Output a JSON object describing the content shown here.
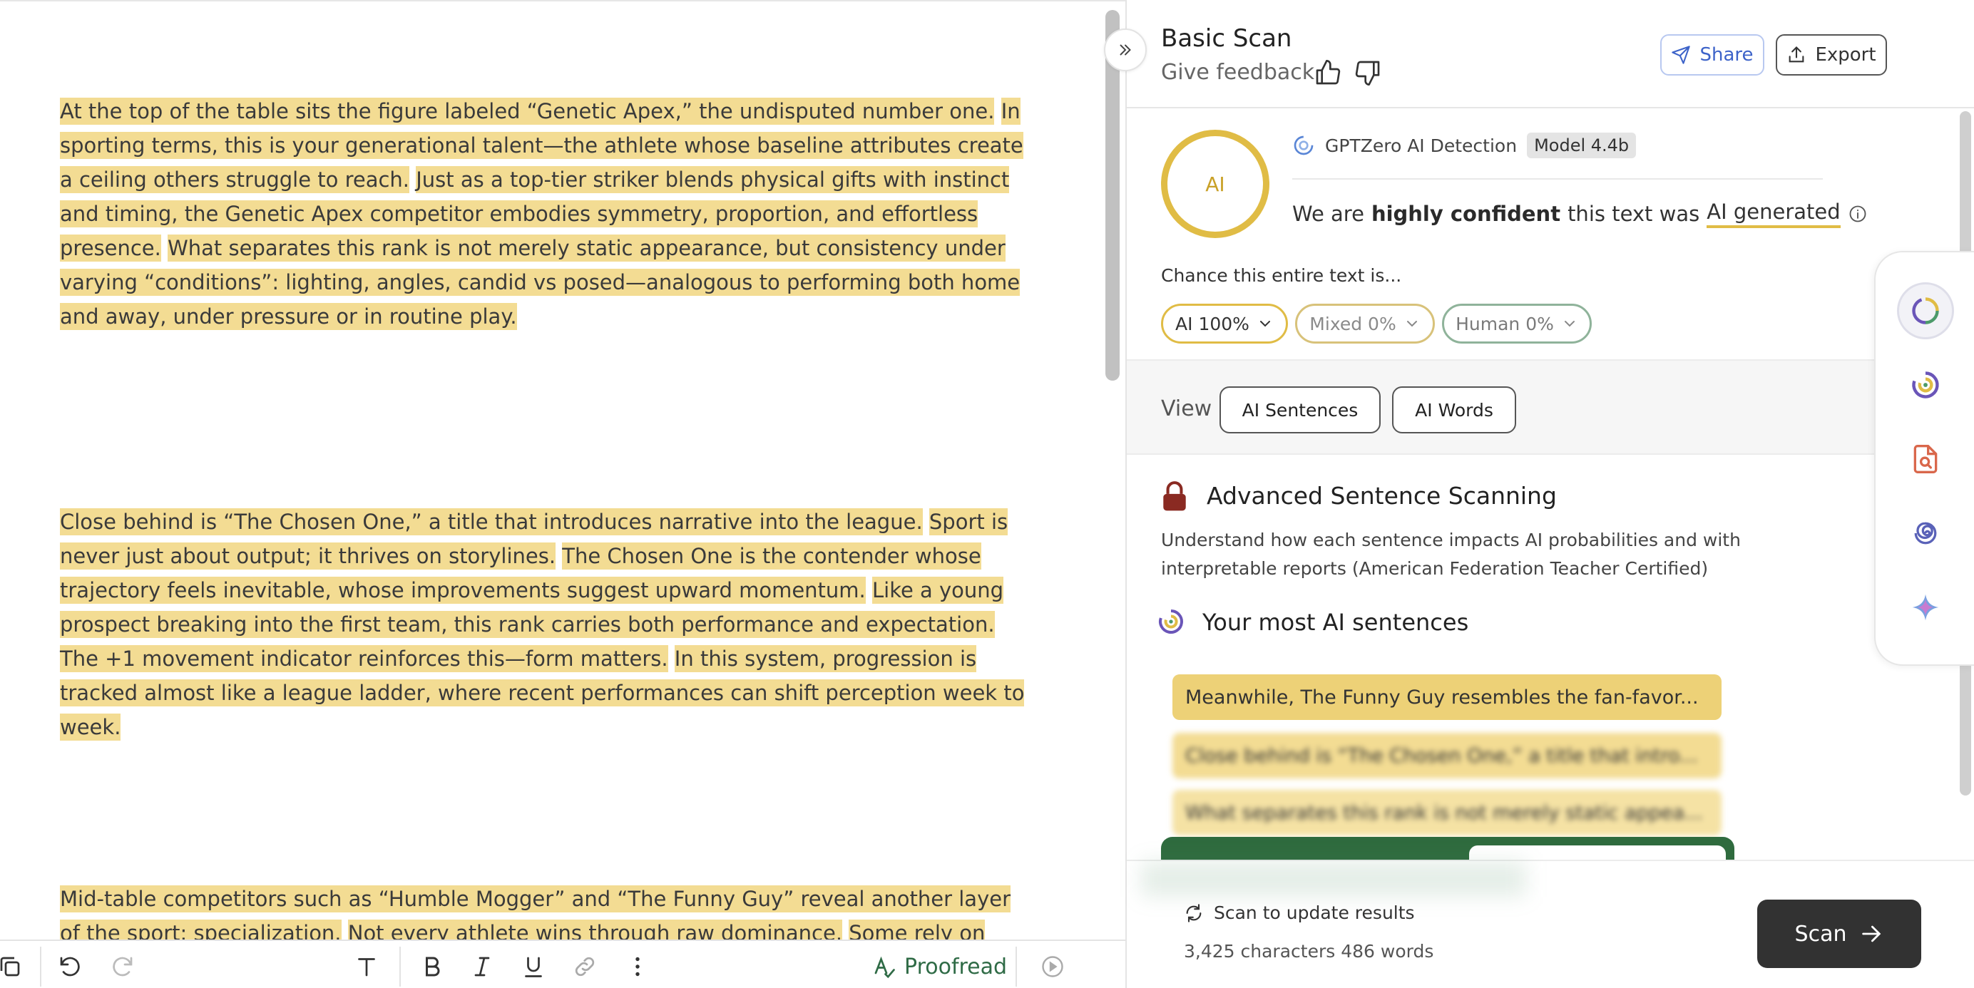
{
  "document": {
    "p1": [
      "At the top of the table sits the figure labeled “Genetic Apex,” the undisputed number one.",
      "In sporting terms, this is your generational talent—the athlete whose baseline attributes create a ceiling others struggle to reach.",
      "Just as a top-tier striker blends physical gifts with instinct and timing, the Genetic Apex competitor embodies symmetry, proportion, and effortless presence.",
      "What separates this rank is not merely static appearance, but consistency under varying “conditions”: lighting, angles, candid vs posed—analogous to performing both home and away, under pressure or in routine play."
    ],
    "p2": [
      "Close behind is “The Chosen One,” a title that introduces narrative into the league.",
      "Sport is never just about output; it thrives on storylines.",
      "The Chosen One is the contender whose trajectory feels inevitable, whose improvements suggest upward momentum.",
      "Like a young prospect breaking into the first team, this rank carries both performance and expectation.",
      "The +1 movement indicator reinforces this—form matters.",
      "In this system, progression is tracked almost like a league ladder, where recent performances can shift perception week to week."
    ],
    "p3": [
      "Mid-table competitors such as “Humble Mogger” and “The Funny Guy” reveal another layer of the sport: specialization.",
      "Not every athlete wins through raw dominance.",
      "Some rely on stylistic flair."
    ]
  },
  "toolbar": {
    "proofread_label": "Proofread"
  },
  "panel": {
    "title": "Basic Scan",
    "feedback": "Give feedback",
    "share_label": "Share",
    "export_label": "Export",
    "ring_label": "AI",
    "detector_name": "GPTZero AI Detection",
    "model_badge": "Model 4.4b",
    "verdict": {
      "prefix": "We are",
      "strong": "highly confident",
      "middle": "this text was",
      "result": "AI generated"
    },
    "chance_label": "Chance this entire text is...",
    "pills": {
      "ai": "AI 100%",
      "mixed": "Mixed 0%",
      "human": "Human 0%"
    },
    "view_label": "View",
    "view_options": [
      "AI Sentences",
      "AI Words"
    ],
    "advanced_title": "Advanced Sentence Scanning",
    "advanced_desc": "Understand how each sentence impacts AI probabilities and with interpretable reports (American Federation Teacher Certified)",
    "most_ai_title": "Your most AI sentences",
    "top_sentences": [
      "Meanwhile, The Funny Guy resembles the fan-favor...",
      "Close behind is “The Chosen One,” a title that intro...",
      "What separates this rank is not merely static appea..."
    ],
    "update_label": "Scan to update results",
    "counts": "3,425 characters 486 words",
    "scan_label": "Scan"
  },
  "colors": {
    "highlight": "#f3dc93",
    "ai_ring": "#e0bc45",
    "share_blue": "#3d63c9",
    "proofread_green": "#2f6b46",
    "scan_button": "#323232"
  },
  "icons": {
    "collapse": "chevron-double-right-icon",
    "thumbs": [
      "thumbs-up-icon",
      "thumbs-down-icon"
    ],
    "rail": [
      "ring-chart-icon",
      "gptzero-logo-icon",
      "document-search-icon",
      "spiral-icon",
      "sparkle-icon"
    ]
  }
}
